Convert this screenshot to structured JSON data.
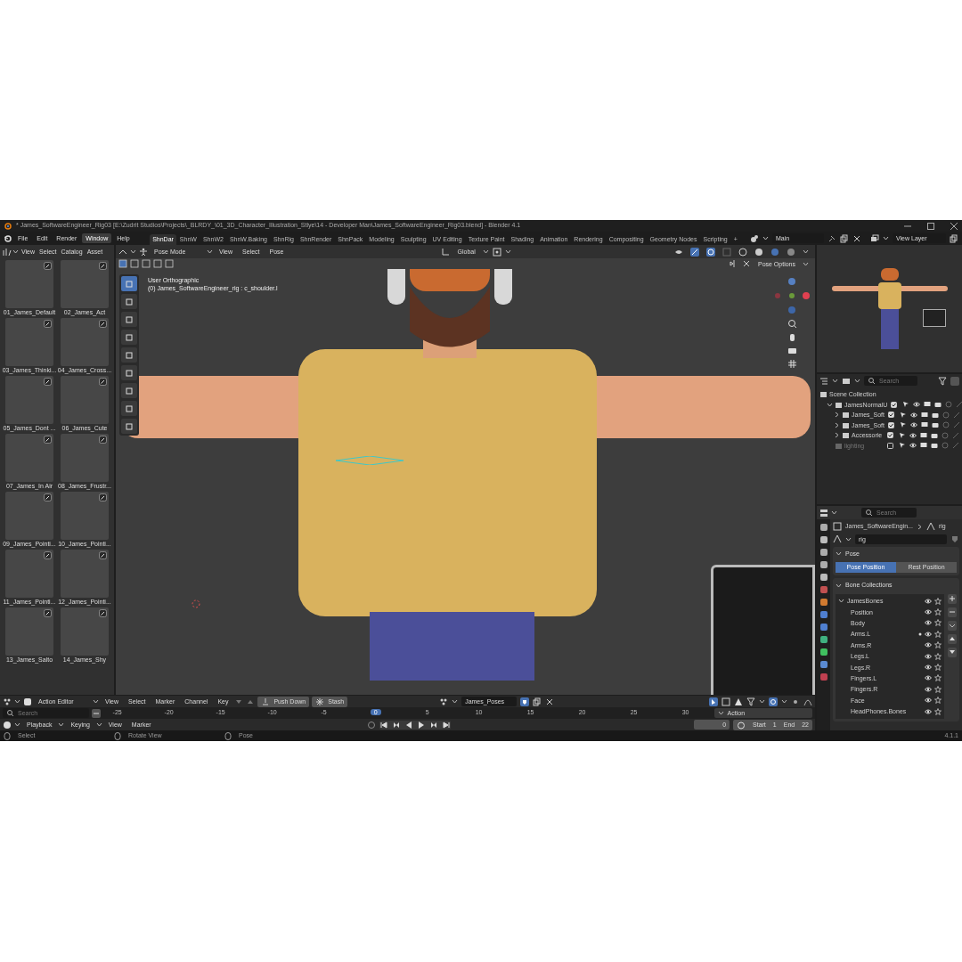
{
  "window": {
    "title": "* James_SoftwareEngineer_Rig03 [E:\\Zudrit Studios\\Projects\\_BLRDY_\\01_3D_Character_Illustration_Stlye\\14 - Developer Man\\James_SoftwareEngineer_Rig03.blend] - Blender 4.1"
  },
  "menu": [
    {
      "label": "File",
      "selected": false
    },
    {
      "label": "Edit",
      "selected": false
    },
    {
      "label": "Render",
      "selected": false
    },
    {
      "label": "Window",
      "selected": true
    },
    {
      "label": "Help",
      "selected": false
    }
  ],
  "workspaces": [
    {
      "label": "ShnDar",
      "selected": true
    },
    {
      "label": "ShnW",
      "selected": false
    },
    {
      "label": "ShnW2",
      "selected": false
    },
    {
      "label": "ShnW.Baking",
      "selected": false
    },
    {
      "label": "ShnRig",
      "selected": false
    },
    {
      "label": "ShnRender",
      "selected": false
    },
    {
      "label": "ShnPack",
      "selected": false
    },
    {
      "label": "Modeling",
      "selected": false
    },
    {
      "label": "Sculpting",
      "selected": false
    },
    {
      "label": "UV Editing",
      "selected": false
    },
    {
      "label": "Texture Paint",
      "selected": false
    },
    {
      "label": "Shading",
      "selected": false
    },
    {
      "label": "Animation",
      "selected": false
    },
    {
      "label": "Rendering",
      "selected": false
    },
    {
      "label": "Compositing",
      "selected": false
    },
    {
      "label": "Geometry Nodes",
      "selected": false
    },
    {
      "label": "Scripting",
      "selected": false
    }
  ],
  "add_workspace": "+",
  "scene": {
    "value": "Main"
  },
  "view_layer": {
    "value": "View Layer"
  },
  "asset_browser": {
    "menu": [
      "View",
      "Select",
      "Catalog",
      "Asset"
    ],
    "assets": [
      {
        "name": "01_James_Default"
      },
      {
        "name": "02_James_Act"
      },
      {
        "name": "03_James_Thinki..."
      },
      {
        "name": "04_James_Cross..."
      },
      {
        "name": "05_James_Dont ..."
      },
      {
        "name": "06_James_Cute"
      },
      {
        "name": "07_James_In Air"
      },
      {
        "name": "08_James_Frustr..."
      },
      {
        "name": "09_James_Pointi..."
      },
      {
        "name": "10_James_Pointi..."
      },
      {
        "name": "11_James_Pointi..."
      },
      {
        "name": "12_James_Pointi..."
      },
      {
        "name": "13_James_Salto"
      },
      {
        "name": "14_James_Shy"
      }
    ]
  },
  "viewport": {
    "mode": "Pose Mode",
    "menu": [
      "View",
      "Select",
      "Pose"
    ],
    "orientation": "Global",
    "pose_options": "Pose Options",
    "overlay_title": "User Orthographic",
    "overlay_info": "(0) James_SoftwareEngineer_rig : c_shoulder.l"
  },
  "outliner": {
    "search_placeholder": "Search",
    "items": [
      {
        "name": "Scene Collection",
        "children": [
          {
            "name": "JamesNormalU",
            "checked": true,
            "expanded": true,
            "children": [
              {
                "name": "James_Soft",
                "checked": true,
                "expanded": false
              },
              {
                "name": "James_Soft",
                "checked": true,
                "expanded": false
              },
              {
                "name": "Accessorie",
                "checked": true,
                "expanded": false
              }
            ]
          },
          {
            "name": "lighting",
            "checked": false
          }
        ]
      }
    ]
  },
  "properties": {
    "search_placeholder": "Search",
    "breadcrumb": [
      "James_SoftwareEngin...",
      "rig"
    ],
    "data_name": "rig",
    "pose_panel": {
      "title": "Pose",
      "expanded": true,
      "options": [
        {
          "label": "Pose Position",
          "selected": true
        },
        {
          "label": "Rest Position",
          "selected": false
        }
      ]
    },
    "bone_panel": {
      "title": "Bone Collections",
      "expanded": true,
      "collections": [
        {
          "name": "JamesBones",
          "expanded": true,
          "has_selected": false,
          "children": [
            {
              "name": "Position",
              "has_selected": false
            },
            {
              "name": "Body",
              "has_selected": false
            },
            {
              "name": "Arms.L",
              "has_selected": true
            },
            {
              "name": "Arms.R",
              "has_selected": false
            },
            {
              "name": "Legs.L",
              "has_selected": false
            },
            {
              "name": "Legs.R",
              "has_selected": false
            },
            {
              "name": "Fingers.L",
              "has_selected": false
            },
            {
              "name": "Fingers.R",
              "has_selected": false
            },
            {
              "name": "Face",
              "has_selected": false
            },
            {
              "name": "HeadPhones.Bones",
              "has_selected": false
            }
          ]
        }
      ]
    }
  },
  "timeline": {
    "editor": "Action Editor",
    "menu": [
      "View",
      "Select",
      "Marker",
      "Channel",
      "Key"
    ],
    "push_down": "Push Down",
    "stash": "Stash",
    "action": "James_Poses",
    "search_placeholder": "Search",
    "ticks": [
      {
        "label": "-25",
        "selected": false
      },
      {
        "label": "-20",
        "selected": false
      },
      {
        "label": "-15",
        "selected": false
      },
      {
        "label": "-10",
        "selected": false
      },
      {
        "label": "-5",
        "selected": false
      },
      {
        "label": "0",
        "selected": true
      },
      {
        "label": "5",
        "selected": false
      },
      {
        "label": "10",
        "selected": false
      },
      {
        "label": "15",
        "selected": false
      },
      {
        "label": "20",
        "selected": false
      },
      {
        "label": "25",
        "selected": false
      },
      {
        "label": "30",
        "selected": false
      }
    ],
    "playback_menu": [
      "Playback",
      "Keying",
      "View",
      "Marker"
    ],
    "action_panel": "Action",
    "frame": "0",
    "start_label": "Start",
    "start": "1",
    "end_label": "End",
    "end": "22"
  },
  "status_bar": {
    "hints": [
      "Select",
      "Rotate View",
      "Pose"
    ],
    "version": "4.1.1"
  }
}
